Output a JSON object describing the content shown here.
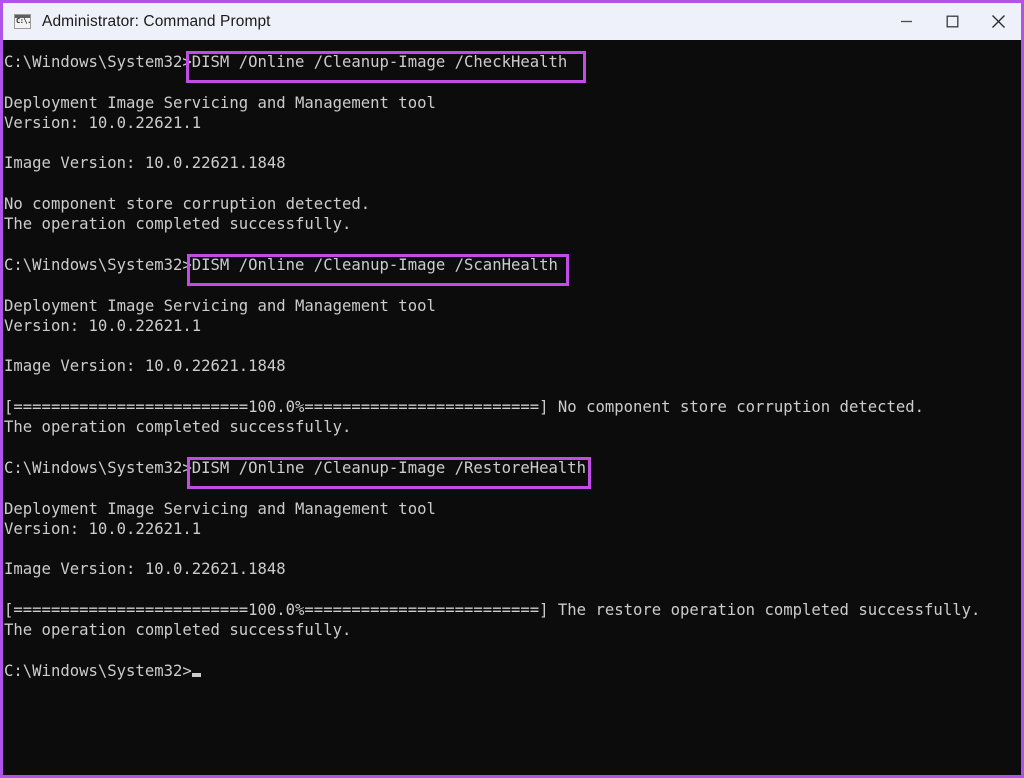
{
  "window": {
    "title": "Administrator: Command Prompt",
    "icon": "command-prompt-icon",
    "icon_glyph": "C:\\.",
    "frame_accent_color": "#b053e8",
    "titlebar_bg": "#eef1f9",
    "terminal_bg": "#0c0c0c",
    "terminal_fg": "#cccccc",
    "highlight_color": "#c24ce6",
    "controls": {
      "minimize_label": "Minimize",
      "maximize_label": "Maximize",
      "close_label": "Close"
    }
  },
  "terminal": {
    "prompt": "C:\\Windows\\System32>",
    "cursor_visible": true,
    "lines": [
      "C:\\Windows\\System32>DISM /Online /Cleanup-Image /CheckHealth",
      "",
      "Deployment Image Servicing and Management tool",
      "Version: 10.0.22621.1",
      "",
      "Image Version: 10.0.22621.1848",
      "",
      "No component store corruption detected.",
      "The operation completed successfully.",
      "",
      "C:\\Windows\\System32>DISM /Online /Cleanup-Image /ScanHealth",
      "",
      "Deployment Image Servicing and Management tool",
      "Version: 10.0.22621.1",
      "",
      "Image Version: 10.0.22621.1848",
      "",
      "[=========================100.0%=========================] No component store corruption detected.",
      "The operation completed successfully.",
      "",
      "C:\\Windows\\System32>DISM /Online /Cleanup-Image /RestoreHealth",
      "",
      "Deployment Image Servicing and Management tool",
      "Version: 10.0.22621.1",
      "",
      "Image Version: 10.0.22621.1848",
      "",
      "[=========================100.0%=========================] The restore operation completed successfully.",
      "The operation completed successfully.",
      "",
      "C:\\Windows\\System32>"
    ],
    "commands": [
      {
        "name": "check-health",
        "text": "DISM /Online /Cleanup-Image /CheckHealth",
        "highlighted": true
      },
      {
        "name": "scan-health",
        "text": "DISM /Online /Cleanup-Image /ScanHealth",
        "highlighted": true
      },
      {
        "name": "restore-health",
        "text": "DISM /Online /Cleanup-Image /RestoreHealth",
        "highlighted": true
      }
    ],
    "progress": {
      "percent_label": "100.0%",
      "value": 100
    },
    "dism": {
      "tool_name": "Deployment Image Servicing and Management tool",
      "version_label": "Version: 10.0.22621.1",
      "image_version_label": "Image Version: 10.0.22621.1848",
      "no_corruption_message": "No component store corruption detected.",
      "success_message": "The operation completed successfully.",
      "restore_success_message": "The restore operation completed successfully."
    }
  }
}
